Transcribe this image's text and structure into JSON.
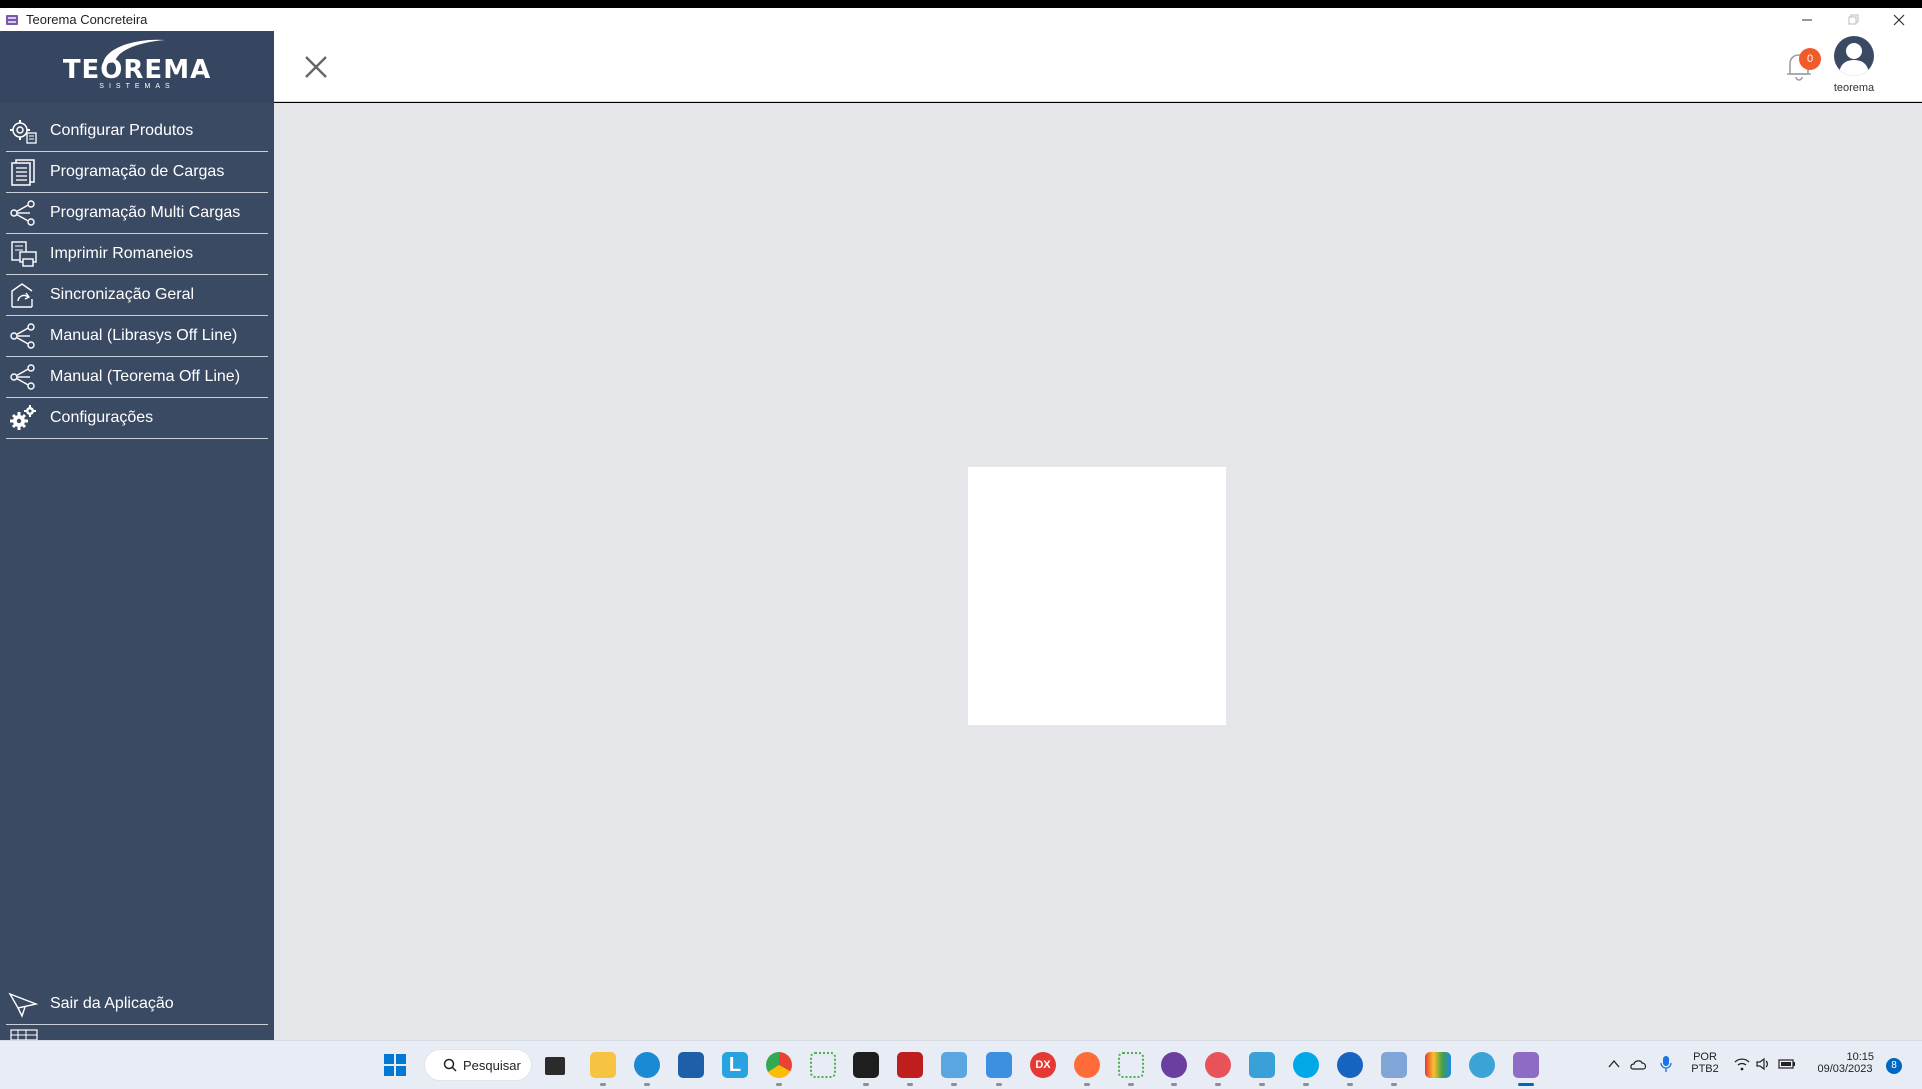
{
  "window": {
    "title": "Teorema Concreteira",
    "controls": [
      "minimize",
      "restore",
      "close"
    ]
  },
  "logo": {
    "brand": "TEOREMA",
    "sub": "SISTEMAS"
  },
  "sidebar": {
    "items": [
      {
        "label": "Configurar Produtos",
        "icon": "gear-settings-icon"
      },
      {
        "label": "Programação de Cargas",
        "icon": "document-list-icon"
      },
      {
        "label": "Programação Multi Cargas",
        "icon": "share-icon"
      },
      {
        "label": "Imprimir Romaneios",
        "icon": "printer-icon"
      },
      {
        "label": "Sincronização Geral",
        "icon": "sync-icon"
      },
      {
        "label": "Manual (Librasys Off Line)",
        "icon": "share-icon"
      },
      {
        "label": "Manual (Teorema Off Line)",
        "icon": "share-icon"
      },
      {
        "label": "Configurações",
        "icon": "gears-icon"
      }
    ],
    "logout": {
      "label": "Sair da Aplicação",
      "icon": "paper-plane-icon"
    }
  },
  "header": {
    "notifications_count": "0",
    "username": "teorema"
  },
  "taskbar": {
    "search_label": "Pesquisar",
    "language_line1": "POR",
    "language_line2": "PTB2",
    "time": "10:15",
    "date": "09/03/2023",
    "notification_count": "8",
    "colors": {
      "start": "#0078d4",
      "accent_red": "#e53935"
    }
  }
}
